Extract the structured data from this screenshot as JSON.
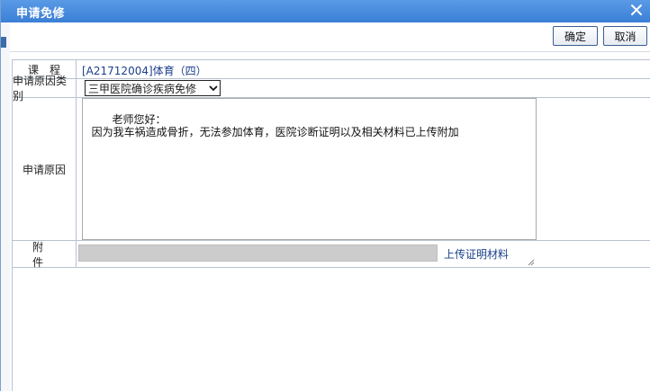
{
  "window": {
    "title": "申请免修",
    "close_icon": "close-icon"
  },
  "toolbar": {
    "confirm_label": "确定",
    "cancel_label": "取消"
  },
  "form": {
    "course_label": "课程",
    "course_value": "[A21712004]体育（四）",
    "reason_type_label": "申请原因类别",
    "reason_type_selected": "三甲医院确诊疾病免修",
    "reason_label": "申请原因",
    "reason_text": "老师您好：\n  因为我车祸造成骨折，无法参加体育，医院诊断证明以及相关材料已上传附加",
    "attachment_label": "附件",
    "upload_link": "上传证明材料"
  },
  "colors": {
    "titlebar": "#3a7fd6",
    "link": "#1b3f8b",
    "file_bar": "#cccccc"
  }
}
